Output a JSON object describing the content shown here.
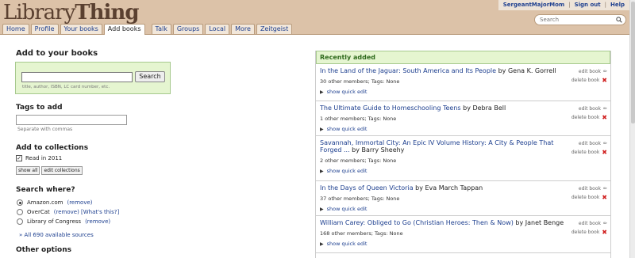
{
  "header": {
    "logo_part1": "Library",
    "logo_part2": "Thing",
    "user": "SergeantMajorMom",
    "sign_out": "Sign out",
    "help": "Help",
    "search_placeholder": "Search"
  },
  "tabs": [
    {
      "label": "Home"
    },
    {
      "label": "Profile"
    },
    {
      "label": "Your books"
    },
    {
      "label": "Add books",
      "active": true
    },
    {
      "label": "Talk"
    },
    {
      "label": "Groups"
    },
    {
      "label": "Local"
    },
    {
      "label": "More"
    },
    {
      "label": "Zeitgeist"
    }
  ],
  "left": {
    "add_title": "Add to your books",
    "search_button": "Search",
    "search_hint": "title, author, ISBN, LC card number, etc.",
    "tags_title": "Tags to add",
    "tags_note": "Separate with commas",
    "collections_title": "Add to collections",
    "collection_item": "Read in 2011",
    "show_all": "show all",
    "edit_collections": "edit collections",
    "search_where_title": "Search where?",
    "sources": [
      {
        "name": "Amazon.com",
        "extra": "(remove)",
        "selected": true
      },
      {
        "name": "OverCat",
        "extra": "(remove) [What's this?]",
        "selected": false
      },
      {
        "name": "Library of Congress",
        "extra": "(remove)",
        "selected": false
      }
    ],
    "all_sources": "» All 690 available sources",
    "other_options": "Other options"
  },
  "recent": {
    "title": "Recently added",
    "edit_label": "edit book",
    "delete_label": "delete book",
    "quick_edit_label": "show quick edit",
    "books": [
      {
        "title": "In the Land of the Jaguar: South America and Its People",
        "author": "by Gena K. Gorrell",
        "meta": "30 other members; Tags: None"
      },
      {
        "title": "The Ultimate Guide to Homeschooling Teens",
        "author": "by Debra Bell",
        "meta": "1 other members; Tags: None"
      },
      {
        "title": "Savannah, Immortal City: An Epic IV Volume History: A City & People That Forged ...",
        "author": "by Barry Sheehy",
        "meta": "2 other members; Tags: None"
      },
      {
        "title": "In the Days of Queen Victoria",
        "author": "by Eva March Tappan",
        "meta": "37 other members; Tags: None"
      },
      {
        "title": "William Carey: Obliged to Go (Christian Heroes: Then & Now)",
        "author": "by Janet Benge",
        "meta": "168 other members; Tags: None"
      }
    ]
  }
}
